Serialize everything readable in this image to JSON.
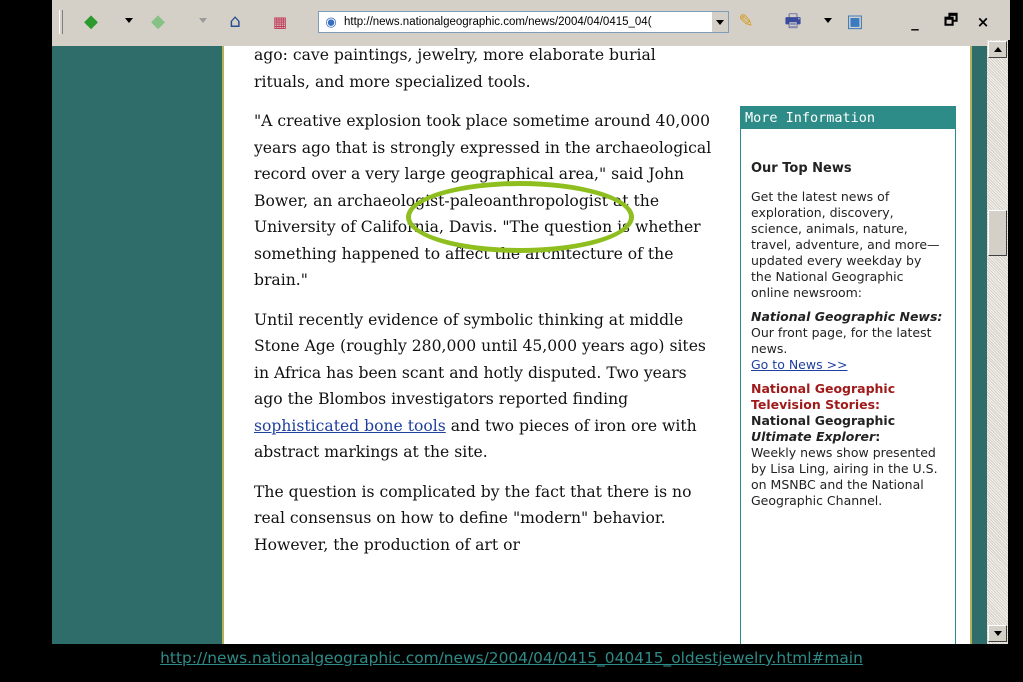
{
  "toolbar": {
    "address_url": "http://news.nationalgeographic.com/news/2004/04/0415_04(",
    "minimize_glyph": "_",
    "restore_glyph": "🗗",
    "close_glyph": "×"
  },
  "article": {
    "para1": "ago: cave paintings, jewelry, more elaborate burial rituals, and more specialized tools.",
    "para2": "\"A creative explosion took place sometime around 40,000 years ago that is strongly expressed in the archaeological record over a very large geographical area,\" said John Bower, an archaeologist-paleoanthropologist at the University of California, Davis. \"The question is whether something happened to affect the architecture of the brain.\"",
    "para3_before_link": "Until recently evidence of symbolic thinking at middle Stone Age (roughly 280,000 until 45,000 years ago) sites in Africa has been scant and hotly disputed. Two years ago the Blombos investigators reported finding ",
    "para3_link": "sophisticated bone tools",
    "para3_after_link": " and two pieces of iron ore with abstract markings at the site.",
    "para4": "The question is complicated by the fact that there is no real consensus on how to define \"modern\" behavior. However, the production of art or"
  },
  "sidebar": {
    "header": "More Information",
    "subhead": "Our Top News",
    "intro": "Get the latest news of exploration, discovery, science, animals, nature, travel, adventure, and more—updated every weekday by the National Geographic online newsroom:",
    "ngn_title": "National Geographic News:",
    "ngn_text": " Our front page, for the latest news.",
    "ngn_link": "Go to News >>",
    "tv_title": "National Geographic Television Stories:",
    "tv_show_a": "National Geographic ",
    "tv_show_b": "Ultimate Explorer",
    "tv_show_c": ":",
    "tv_text": "Weekly news show presented by Lisa Ling, airing in the U.S. on MSNBC and the National Geographic Channel."
  },
  "status": {
    "url": "http://news.nationalgeographic.com/news/2004/04/0415_040415_oldestjewelry.html#main"
  },
  "colors": {
    "page_bg": "#2e6d69",
    "sidebar_accent": "#2e8c88",
    "annotation_ellipse": "#8fbf1f",
    "link": "#1f3f9e"
  }
}
